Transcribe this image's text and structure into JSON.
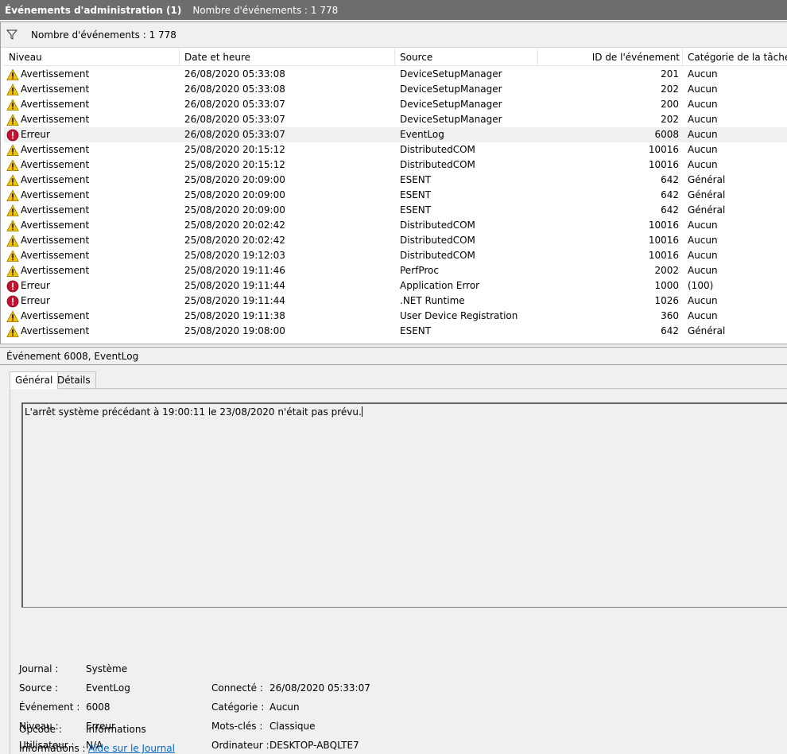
{
  "titlebar": {
    "title": "Événements d'administration (1)",
    "count": "Nombre d'événements : 1 778"
  },
  "filterbar": {
    "count": "Nombre d'événements : 1 778"
  },
  "columns": [
    "Niveau",
    "Date et heure",
    "Source",
    "ID de l'événement",
    "Catégorie de la tâche"
  ],
  "rows": [
    {
      "level": "Avertissement",
      "icon": "warning-icon",
      "date": "26/08/2020 05:33:08",
      "source": "DeviceSetupManager",
      "id": "201",
      "category": "Aucun"
    },
    {
      "level": "Avertissement",
      "icon": "warning-icon",
      "date": "26/08/2020 05:33:08",
      "source": "DeviceSetupManager",
      "id": "202",
      "category": "Aucun"
    },
    {
      "level": "Avertissement",
      "icon": "warning-icon",
      "date": "26/08/2020 05:33:07",
      "source": "DeviceSetupManager",
      "id": "200",
      "category": "Aucun"
    },
    {
      "level": "Avertissement",
      "icon": "warning-icon",
      "date": "26/08/2020 05:33:07",
      "source": "DeviceSetupManager",
      "id": "202",
      "category": "Aucun"
    },
    {
      "level": "Erreur",
      "icon": "error-icon",
      "date": "26/08/2020 05:33:07",
      "source": "EventLog",
      "id": "6008",
      "category": "Aucun",
      "selected": true
    },
    {
      "level": "Avertissement",
      "icon": "warning-icon",
      "date": "25/08/2020 20:15:12",
      "source": "DistributedCOM",
      "id": "10016",
      "category": "Aucun"
    },
    {
      "level": "Avertissement",
      "icon": "warning-icon",
      "date": "25/08/2020 20:15:12",
      "source": "DistributedCOM",
      "id": "10016",
      "category": "Aucun"
    },
    {
      "level": "Avertissement",
      "icon": "warning-icon",
      "date": "25/08/2020 20:09:00",
      "source": "ESENT",
      "id": "642",
      "category": "Général"
    },
    {
      "level": "Avertissement",
      "icon": "warning-icon",
      "date": "25/08/2020 20:09:00",
      "source": "ESENT",
      "id": "642",
      "category": "Général"
    },
    {
      "level": "Avertissement",
      "icon": "warning-icon",
      "date": "25/08/2020 20:09:00",
      "source": "ESENT",
      "id": "642",
      "category": "Général"
    },
    {
      "level": "Avertissement",
      "icon": "warning-icon",
      "date": "25/08/2020 20:02:42",
      "source": "DistributedCOM",
      "id": "10016",
      "category": "Aucun"
    },
    {
      "level": "Avertissement",
      "icon": "warning-icon",
      "date": "25/08/2020 20:02:42",
      "source": "DistributedCOM",
      "id": "10016",
      "category": "Aucun"
    },
    {
      "level": "Avertissement",
      "icon": "warning-icon",
      "date": "25/08/2020 19:12:03",
      "source": "DistributedCOM",
      "id": "10016",
      "category": "Aucun"
    },
    {
      "level": "Avertissement",
      "icon": "warning-icon",
      "date": "25/08/2020 19:11:46",
      "source": "PerfProc",
      "id": "2002",
      "category": "Aucun"
    },
    {
      "level": "Erreur",
      "icon": "error-icon",
      "date": "25/08/2020 19:11:44",
      "source": "Application Error",
      "id": "1000",
      "category": "(100)"
    },
    {
      "level": "Erreur",
      "icon": "error-icon",
      "date": "25/08/2020 19:11:44",
      "source": ".NET Runtime",
      "id": "1026",
      "category": "Aucun"
    },
    {
      "level": "Avertissement",
      "icon": "warning-icon",
      "date": "25/08/2020 19:11:38",
      "source": "User Device Registration",
      "id": "360",
      "category": "Aucun"
    },
    {
      "level": "Avertissement",
      "icon": "warning-icon",
      "date": "25/08/2020 19:08:00",
      "source": "ESENT",
      "id": "642",
      "category": "Général"
    }
  ],
  "detail": {
    "title": "Événement 6008, EventLog",
    "tabs": [
      "Général",
      "Détails"
    ],
    "description": "L'arrêt système précédant à 19:00:11 le 23/08/2020 n'était pas prévu.",
    "fields": {
      "journal_label": "Journal :",
      "journal": "Système",
      "source_label": "Source :",
      "source": "EventLog",
      "event_label": "Événement :",
      "event": "6008",
      "level_label": "Niveau :",
      "level": "Erreur",
      "user_label": "Utilisateur :",
      "user": "N/A",
      "opcode_label": "Opcode :",
      "opcode": "Informations",
      "info_label": "Informations :",
      "info_link": "Aide sur le Journal",
      "logged_label": "Connecté :",
      "logged": "26/08/2020 05:33:07",
      "category_label": "Catégorie :",
      "category": "Aucun",
      "keywords_label": "Mots-clés :",
      "keywords": "Classique",
      "computer_label": "Ordinateur :",
      "computer": "DESKTOP-ABQLTE7"
    }
  },
  "colors": {
    "titlebar_bg": "#6d6d6d",
    "selected_row": "#f0f0f0",
    "link": "#0066cc",
    "warning": "#f5c400",
    "error": "#c8102e"
  }
}
